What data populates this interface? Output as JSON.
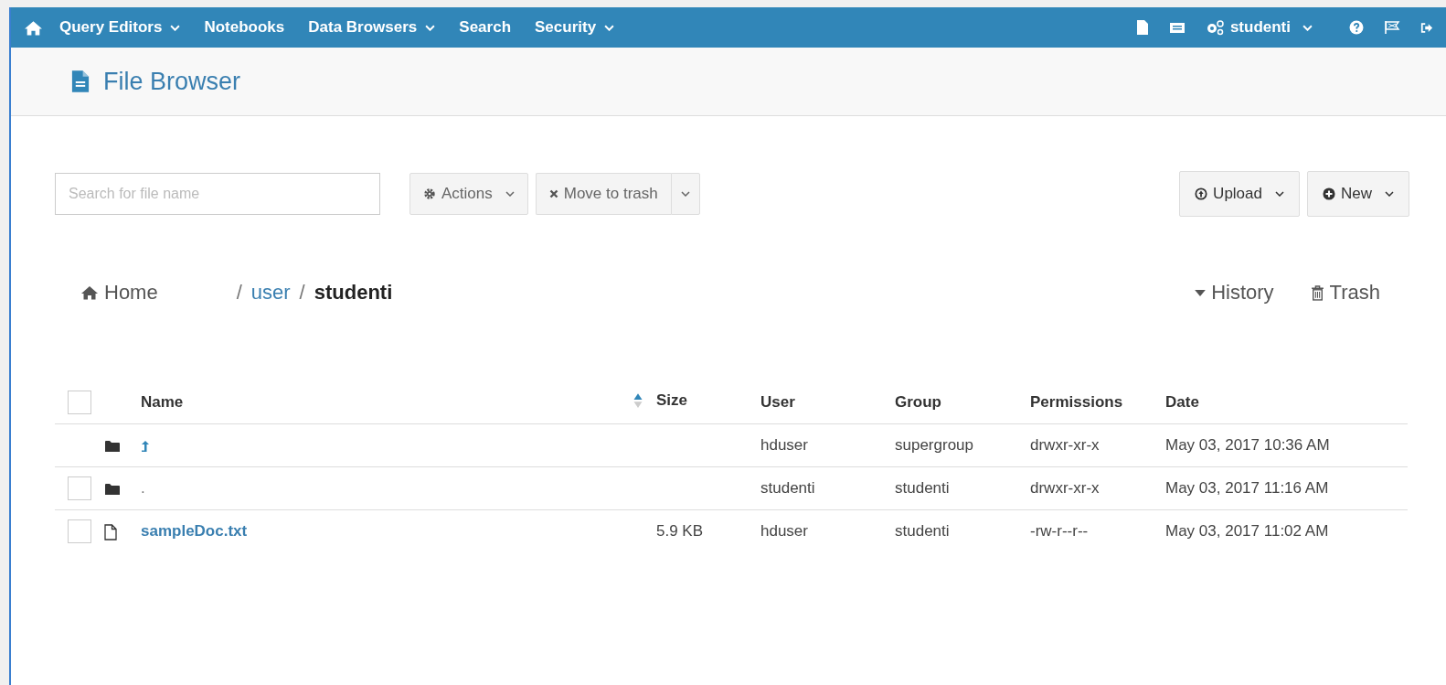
{
  "navbar": {
    "left": [
      {
        "label": "Query Editors",
        "dropdown": true
      },
      {
        "label": "Notebooks",
        "dropdown": false
      },
      {
        "label": "Data Browsers",
        "dropdown": true
      },
      {
        "label": "Search",
        "dropdown": false
      },
      {
        "label": "Security",
        "dropdown": true
      }
    ],
    "user": "studenti"
  },
  "header": {
    "title": "File Browser"
  },
  "toolbar": {
    "search": {
      "placeholder": "Search for file name"
    },
    "actions": "Actions",
    "move_to_trash": "Move to trash",
    "upload": "Upload",
    "new": "New"
  },
  "breadcrumb": {
    "home": "Home",
    "separators": [
      "/",
      "/"
    ],
    "path": [
      {
        "label": "user",
        "current": false
      },
      {
        "label": "studenti",
        "current": true
      }
    ]
  },
  "links": {
    "history": "History",
    "trash": "Trash"
  },
  "table": {
    "select_all": {
      "checked": false
    },
    "columns": [
      "Name",
      "Size",
      "User",
      "Group",
      "Permissions",
      "Date"
    ],
    "rows": [
      {
        "kind": "parent",
        "name": "",
        "size": "",
        "user": "hduser",
        "group": "supergroup",
        "permissions": "drwxr-xr-x",
        "date": "May 03, 2017 10:36 AM"
      },
      {
        "kind": "folder",
        "name": ".",
        "size": "",
        "user": "studenti",
        "group": "studenti",
        "permissions": "drwxr-xr-x",
        "date": "May 03, 2017 11:16 AM",
        "checked": false
      },
      {
        "kind": "file",
        "name": "sampleDoc.txt",
        "size": "5.9 KB",
        "user": "hduser",
        "group": "studenti",
        "permissions": "-rw-r--r--",
        "date": "May 03, 2017 11:02 AM",
        "checked": false
      }
    ]
  }
}
